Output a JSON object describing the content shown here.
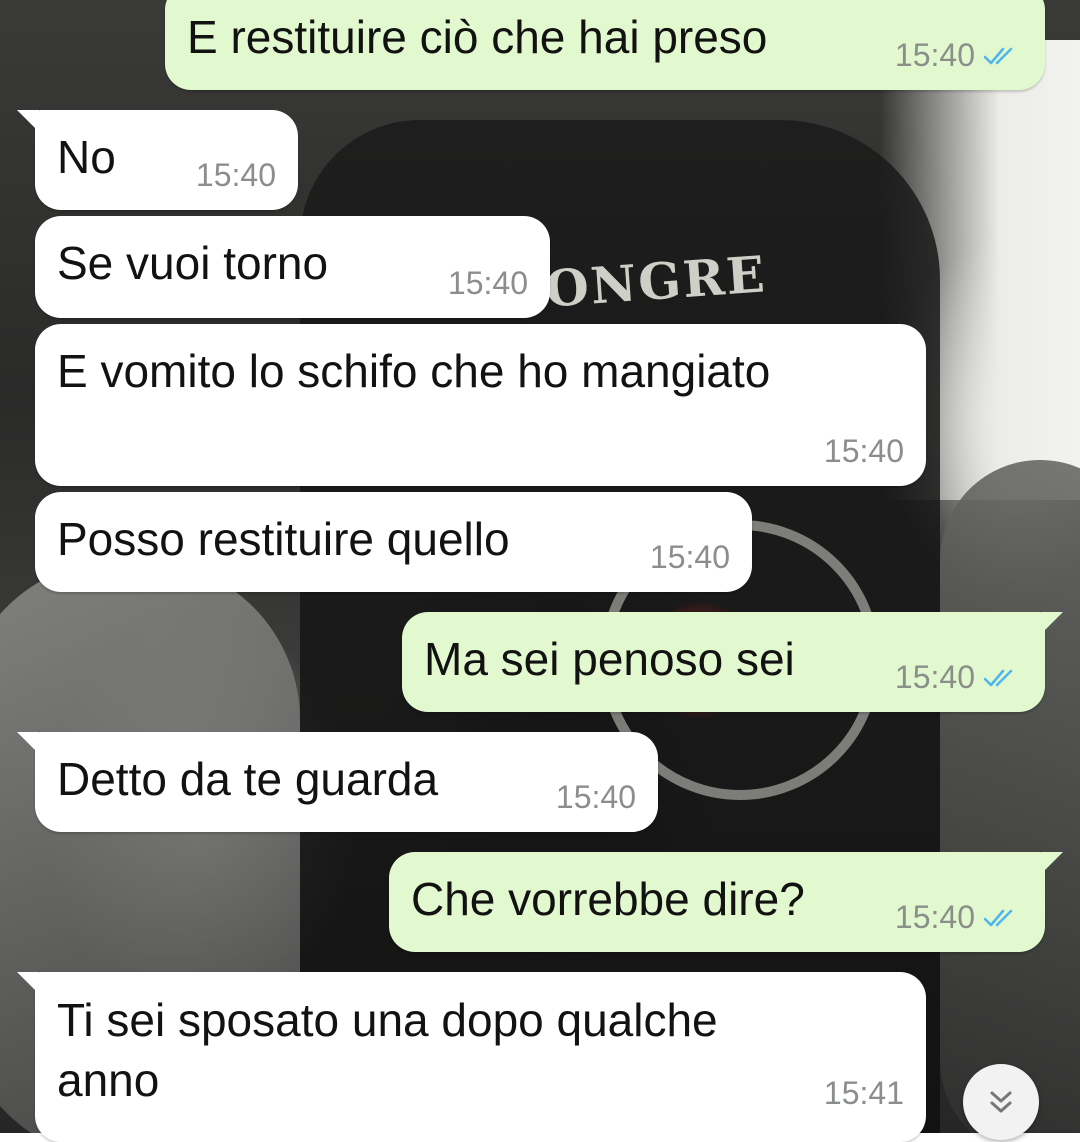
{
  "wallpaper": {
    "patch_text": "ONGRE"
  },
  "status_colors": {
    "read_ticks": "#4fb6ec",
    "outgoing_bubble": "#e2f9cf",
    "incoming_bubble": "#ffffff"
  },
  "messages": [
    {
      "direction": "outgoing",
      "text": "E restituire ciò che hai preso",
      "time": "15:40",
      "status": "read"
    },
    {
      "direction": "incoming",
      "text": "No",
      "time": "15:40"
    },
    {
      "direction": "incoming",
      "text": "Se vuoi torno",
      "time": "15:40"
    },
    {
      "direction": "incoming",
      "text": "E vomito lo schifo che ho mangiato",
      "time": "15:40"
    },
    {
      "direction": "incoming",
      "text": "Posso restituire quello",
      "time": "15:40"
    },
    {
      "direction": "outgoing",
      "text": "Ma sei penoso sei",
      "time": "15:40",
      "status": "read"
    },
    {
      "direction": "incoming",
      "text": "Detto da te guarda",
      "time": "15:40"
    },
    {
      "direction": "outgoing",
      "text": "Che vorrebbe dire?",
      "time": "15:40",
      "status": "read"
    },
    {
      "direction": "incoming",
      "text": "Ti sei sposato una dopo qualche\nanno",
      "time": "15:41"
    }
  ],
  "scroll_button": {
    "icon": "double-chevron-down-icon"
  }
}
